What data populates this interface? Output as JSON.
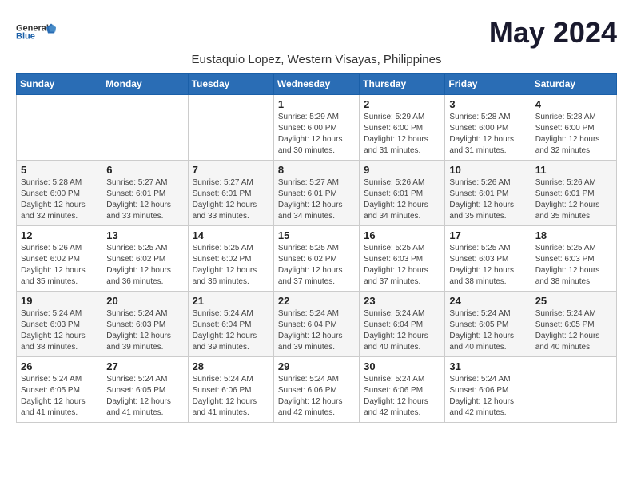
{
  "header": {
    "logo_general": "General",
    "logo_blue": "Blue",
    "month_title": "May 2024",
    "location": "Eustaquio Lopez, Western Visayas, Philippines"
  },
  "columns": [
    "Sunday",
    "Monday",
    "Tuesday",
    "Wednesday",
    "Thursday",
    "Friday",
    "Saturday"
  ],
  "weeks": [
    {
      "days": [
        {
          "num": "",
          "info": ""
        },
        {
          "num": "",
          "info": ""
        },
        {
          "num": "",
          "info": ""
        },
        {
          "num": "1",
          "info": "Sunrise: 5:29 AM\nSunset: 6:00 PM\nDaylight: 12 hours and 30 minutes."
        },
        {
          "num": "2",
          "info": "Sunrise: 5:29 AM\nSunset: 6:00 PM\nDaylight: 12 hours and 31 minutes."
        },
        {
          "num": "3",
          "info": "Sunrise: 5:28 AM\nSunset: 6:00 PM\nDaylight: 12 hours and 31 minutes."
        },
        {
          "num": "4",
          "info": "Sunrise: 5:28 AM\nSunset: 6:00 PM\nDaylight: 12 hours and 32 minutes."
        }
      ]
    },
    {
      "days": [
        {
          "num": "5",
          "info": "Sunrise: 5:28 AM\nSunset: 6:00 PM\nDaylight: 12 hours and 32 minutes."
        },
        {
          "num": "6",
          "info": "Sunrise: 5:27 AM\nSunset: 6:01 PM\nDaylight: 12 hours and 33 minutes."
        },
        {
          "num": "7",
          "info": "Sunrise: 5:27 AM\nSunset: 6:01 PM\nDaylight: 12 hours and 33 minutes."
        },
        {
          "num": "8",
          "info": "Sunrise: 5:27 AM\nSunset: 6:01 PM\nDaylight: 12 hours and 34 minutes."
        },
        {
          "num": "9",
          "info": "Sunrise: 5:26 AM\nSunset: 6:01 PM\nDaylight: 12 hours and 34 minutes."
        },
        {
          "num": "10",
          "info": "Sunrise: 5:26 AM\nSunset: 6:01 PM\nDaylight: 12 hours and 35 minutes."
        },
        {
          "num": "11",
          "info": "Sunrise: 5:26 AM\nSunset: 6:01 PM\nDaylight: 12 hours and 35 minutes."
        }
      ]
    },
    {
      "days": [
        {
          "num": "12",
          "info": "Sunrise: 5:26 AM\nSunset: 6:02 PM\nDaylight: 12 hours and 35 minutes."
        },
        {
          "num": "13",
          "info": "Sunrise: 5:25 AM\nSunset: 6:02 PM\nDaylight: 12 hours and 36 minutes."
        },
        {
          "num": "14",
          "info": "Sunrise: 5:25 AM\nSunset: 6:02 PM\nDaylight: 12 hours and 36 minutes."
        },
        {
          "num": "15",
          "info": "Sunrise: 5:25 AM\nSunset: 6:02 PM\nDaylight: 12 hours and 37 minutes."
        },
        {
          "num": "16",
          "info": "Sunrise: 5:25 AM\nSunset: 6:03 PM\nDaylight: 12 hours and 37 minutes."
        },
        {
          "num": "17",
          "info": "Sunrise: 5:25 AM\nSunset: 6:03 PM\nDaylight: 12 hours and 38 minutes."
        },
        {
          "num": "18",
          "info": "Sunrise: 5:25 AM\nSunset: 6:03 PM\nDaylight: 12 hours and 38 minutes."
        }
      ]
    },
    {
      "days": [
        {
          "num": "19",
          "info": "Sunrise: 5:24 AM\nSunset: 6:03 PM\nDaylight: 12 hours and 38 minutes."
        },
        {
          "num": "20",
          "info": "Sunrise: 5:24 AM\nSunset: 6:03 PM\nDaylight: 12 hours and 39 minutes."
        },
        {
          "num": "21",
          "info": "Sunrise: 5:24 AM\nSunset: 6:04 PM\nDaylight: 12 hours and 39 minutes."
        },
        {
          "num": "22",
          "info": "Sunrise: 5:24 AM\nSunset: 6:04 PM\nDaylight: 12 hours and 39 minutes."
        },
        {
          "num": "23",
          "info": "Sunrise: 5:24 AM\nSunset: 6:04 PM\nDaylight: 12 hours and 40 minutes."
        },
        {
          "num": "24",
          "info": "Sunrise: 5:24 AM\nSunset: 6:05 PM\nDaylight: 12 hours and 40 minutes."
        },
        {
          "num": "25",
          "info": "Sunrise: 5:24 AM\nSunset: 6:05 PM\nDaylight: 12 hours and 40 minutes."
        }
      ]
    },
    {
      "days": [
        {
          "num": "26",
          "info": "Sunrise: 5:24 AM\nSunset: 6:05 PM\nDaylight: 12 hours and 41 minutes."
        },
        {
          "num": "27",
          "info": "Sunrise: 5:24 AM\nSunset: 6:05 PM\nDaylight: 12 hours and 41 minutes."
        },
        {
          "num": "28",
          "info": "Sunrise: 5:24 AM\nSunset: 6:06 PM\nDaylight: 12 hours and 41 minutes."
        },
        {
          "num": "29",
          "info": "Sunrise: 5:24 AM\nSunset: 6:06 PM\nDaylight: 12 hours and 42 minutes."
        },
        {
          "num": "30",
          "info": "Sunrise: 5:24 AM\nSunset: 6:06 PM\nDaylight: 12 hours and 42 minutes."
        },
        {
          "num": "31",
          "info": "Sunrise: 5:24 AM\nSunset: 6:06 PM\nDaylight: 12 hours and 42 minutes."
        },
        {
          "num": "",
          "info": ""
        }
      ]
    }
  ]
}
